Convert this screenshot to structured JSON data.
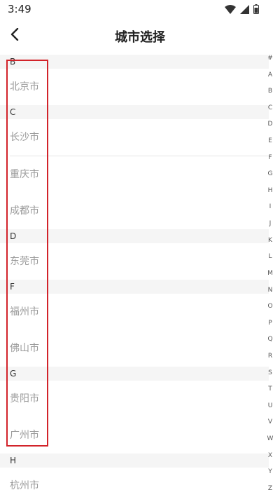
{
  "status_bar": {
    "time": "3:49",
    "icons": [
      "wifi-icon",
      "signal-icon",
      "battery-icon"
    ]
  },
  "header": {
    "title": "城市选择",
    "back_icon": "chevron-left-icon"
  },
  "groups": [
    {
      "letter": "B",
      "cities": [
        "北京市"
      ]
    },
    {
      "letter": "C",
      "cities": [
        "长沙市",
        "重庆市",
        "成都市"
      ]
    },
    {
      "letter": "D",
      "cities": [
        "东莞市"
      ]
    },
    {
      "letter": "F",
      "cities": [
        "福州市",
        "佛山市"
      ]
    },
    {
      "letter": "G",
      "cities": [
        "贵阳市",
        "广州市"
      ]
    },
    {
      "letter": "H",
      "cities": [
        "杭州市"
      ]
    }
  ],
  "index_letters": [
    "#",
    "A",
    "B",
    "C",
    "D",
    "E",
    "F",
    "G",
    "H",
    "I",
    "J",
    "K",
    "L",
    "M",
    "N",
    "O",
    "P",
    "Q",
    "R",
    "S",
    "T",
    "U",
    "V",
    "W",
    "X",
    "Y",
    "Z"
  ],
  "colors": {
    "highlight": "#d2232a",
    "group_bg": "#f5f5f5",
    "city_text": "#9a9a9a"
  }
}
